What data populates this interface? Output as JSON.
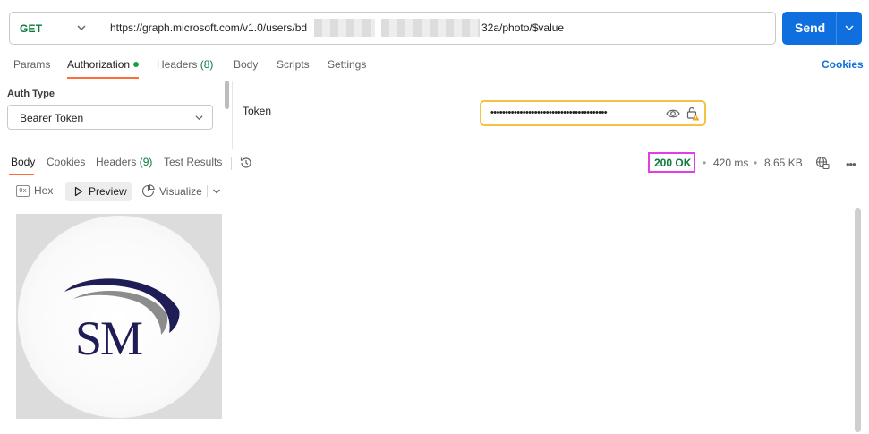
{
  "request": {
    "method": "GET",
    "url_prefix": "https://graph.microsoft.com/v1.0/users/bd",
    "url_suffix": "32a/photo/$value",
    "send_label": "Send"
  },
  "request_tabs": {
    "params": "Params",
    "authorization": "Authorization",
    "headers": "Headers",
    "headers_count": "(8)",
    "body": "Body",
    "scripts": "Scripts",
    "settings": "Settings",
    "cookies": "Cookies"
  },
  "auth": {
    "type_label": "Auth Type",
    "type_value": "Bearer Token",
    "token_label": "Token",
    "token_masked": "••••••••••••••••••••••••••••••••••••••••"
  },
  "response_tabs": {
    "body": "Body",
    "cookies": "Cookies",
    "headers": "Headers",
    "headers_count": "(9)",
    "test_results": "Test Results"
  },
  "response_meta": {
    "status": "200 OK",
    "time": "420 ms",
    "size": "8.65 KB",
    "separator": "•",
    "more": "•••"
  },
  "view_modes": {
    "hex": "Hex",
    "preview": "Preview",
    "visualize": "Visualize"
  },
  "preview_image": {
    "logo_text": "SM",
    "colors": {
      "navy": "#1f1d55",
      "gray": "#8c8c8c"
    }
  },
  "colors": {
    "accent": "#0f6fde",
    "tab_underline": "#ff6c37",
    "success": "#0b7a3e",
    "status_highlight": "#e13ee6",
    "token_highlight": "#f5c242"
  }
}
